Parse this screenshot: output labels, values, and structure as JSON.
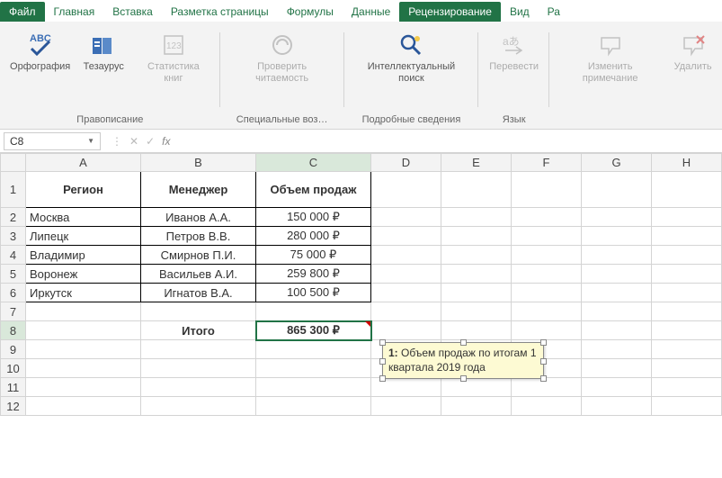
{
  "tabs": {
    "file": "Файл",
    "home": "Главная",
    "insert": "Вставка",
    "layout": "Разметка страницы",
    "formulas": "Формулы",
    "data": "Данные",
    "review": "Рецензирование",
    "view": "Вид",
    "ra": "Ра"
  },
  "ribbon": {
    "spellcheck": "Орфография",
    "thesaurus": "Тезаурус",
    "bookstats": "Статистика книг",
    "group_spell": "Правописание",
    "readability": "Проверить читаемость",
    "group_special": "Специальные воз…",
    "smartlookup": "Интеллектуальный поиск",
    "group_details": "Подробные сведения",
    "translate": "Перевести",
    "group_lang": "Язык",
    "editcomment": "Изменить примечание",
    "deletecomment": "Удалить"
  },
  "namebox": "C8",
  "headers": {
    "A": "Регион",
    "B": "Менеджер",
    "C": "Объем продаж"
  },
  "rows": [
    {
      "region": "Москва",
      "manager": "Иванов А.А.",
      "amount": "150 000 ₽"
    },
    {
      "region": "Липецк",
      "manager": "Петров В.В.",
      "amount": "280 000 ₽"
    },
    {
      "region": "Владимир",
      "manager": "Смирнов П.И.",
      "amount": "75 000 ₽"
    },
    {
      "region": "Воронеж",
      "manager": "Васильев А.И.",
      "amount": "259 800 ₽"
    },
    {
      "region": "Иркутск",
      "manager": "Игнатов В.А.",
      "amount": "100 500 ₽"
    }
  ],
  "total": {
    "label": "Итого",
    "value": "865 300 ₽"
  },
  "comment": {
    "author": "1:",
    "text": "Объем продаж по итогам 1 квартала 2019 года"
  },
  "cols": [
    "A",
    "B",
    "C",
    "D",
    "E",
    "F",
    "G",
    "H"
  ],
  "rownums": [
    "1",
    "2",
    "3",
    "4",
    "5",
    "6",
    "7",
    "8",
    "9",
    "10",
    "11",
    "12"
  ]
}
